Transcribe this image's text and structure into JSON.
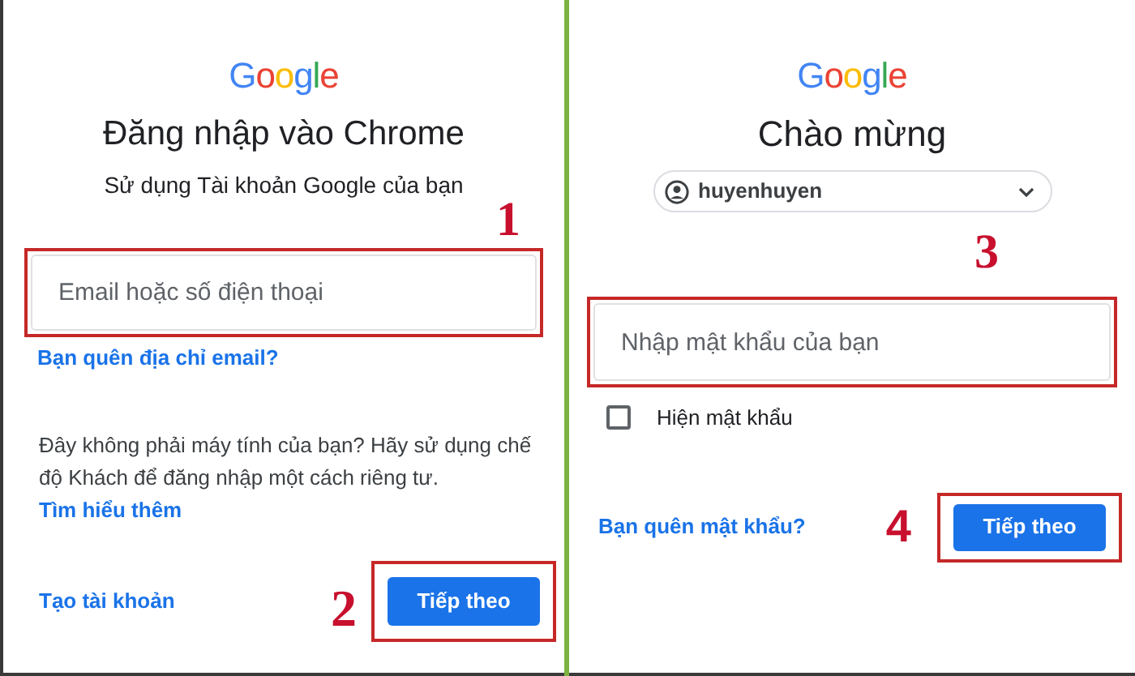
{
  "left_panel": {
    "logo": "Google",
    "title": "Đăng nhập vào Chrome",
    "subtitle": "Sử dụng Tài khoản Google của bạn",
    "step_1": "1",
    "email_field": {
      "placeholder": "Email hoặc số điện thoại"
    },
    "forgot_email_link": "Bạn quên địa chỉ email?",
    "guest_notice": "Đây không phải máy tính của bạn? Hãy sử dụng chế độ Khách để đăng nhập một cách riêng tư.",
    "learn_more_link": "Tìm hiểu thêm",
    "create_account_link": "Tạo tài khoản",
    "step_2": "2",
    "next_button": "Tiếp theo"
  },
  "right_panel": {
    "logo": "Google",
    "title": "Chào mừng",
    "account": {
      "email": "huyenhuyen"
    },
    "step_3": "3",
    "password_field": {
      "placeholder": "Nhập mật khẩu của bạn"
    },
    "show_password": {
      "label": "Hiện mật khẩu",
      "checked": false
    },
    "forgot_password_link": "Bạn quên mật khẩu?",
    "step_4": "4",
    "next_button": "Tiếp theo"
  }
}
